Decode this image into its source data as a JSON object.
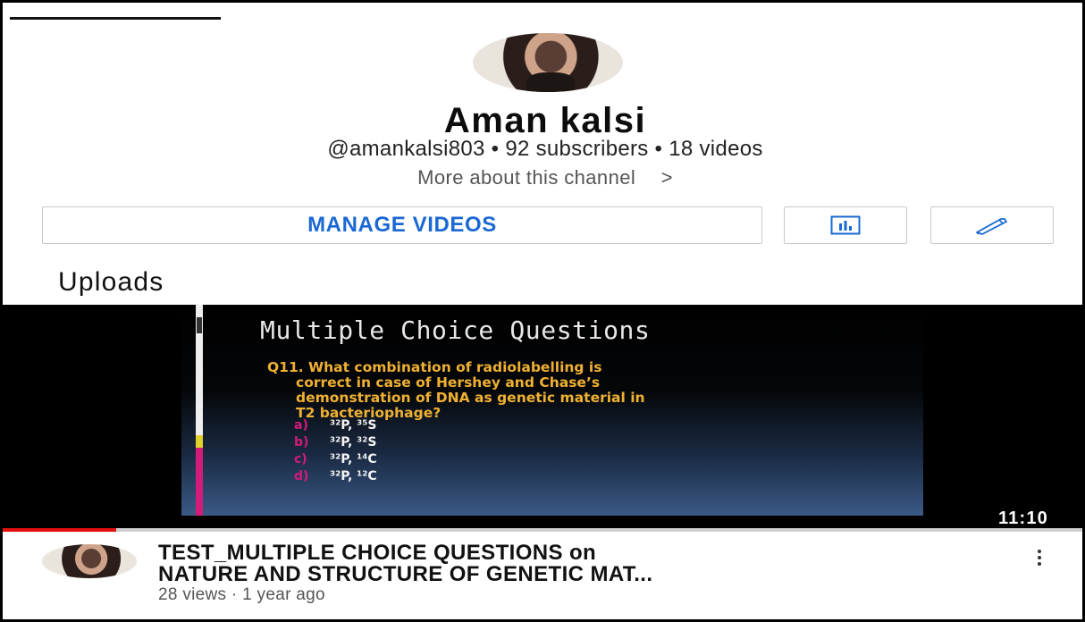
{
  "channel": {
    "name": "Aman kalsi",
    "meta": "@amankalsi803 • 92 subscribers • 18 videos",
    "more_about": "More about this channel",
    "more_about_chevron": ">"
  },
  "actions": {
    "manage_label": "MANAGE VIDEOS",
    "analytics_icon": "analytics-icon",
    "edit_icon": "pencil-icon",
    "accent_color": "#1a68d3"
  },
  "uploads": {
    "heading": "Uploads",
    "videos": [
      {
        "title_line1": "TEST_MULTIPLE CHOICE QUESTIONS on",
        "title_line2": "NATURE AND STRUCTURE OF GENETIC MAT...",
        "meta": "28 views · 1 year ago",
        "duration": "11:10",
        "watch_progress": 0.105,
        "thumbnail": {
          "heading": "Multiple Choice Questions",
          "question_line1": "Q11. What combination of radiolabelling is",
          "question_line2": "correct in case of Hershey and Chase’s",
          "question_line3": "demonstration of DNA as genetic material in",
          "question_line4": "T2 bacteriophage?",
          "options": [
            {
              "letter": "a)",
              "text": "³²P, ³⁵S"
            },
            {
              "letter": "b)",
              "text": "³²P, ³²S"
            },
            {
              "letter": "c)",
              "text": "³²P, ¹⁴C"
            },
            {
              "letter": "d)",
              "text": "³²P, ¹²C"
            }
          ]
        }
      }
    ]
  },
  "colors": {
    "progress": "#e10f0f",
    "question_text": "#f0b132",
    "option_letter": "#d21c7a"
  }
}
